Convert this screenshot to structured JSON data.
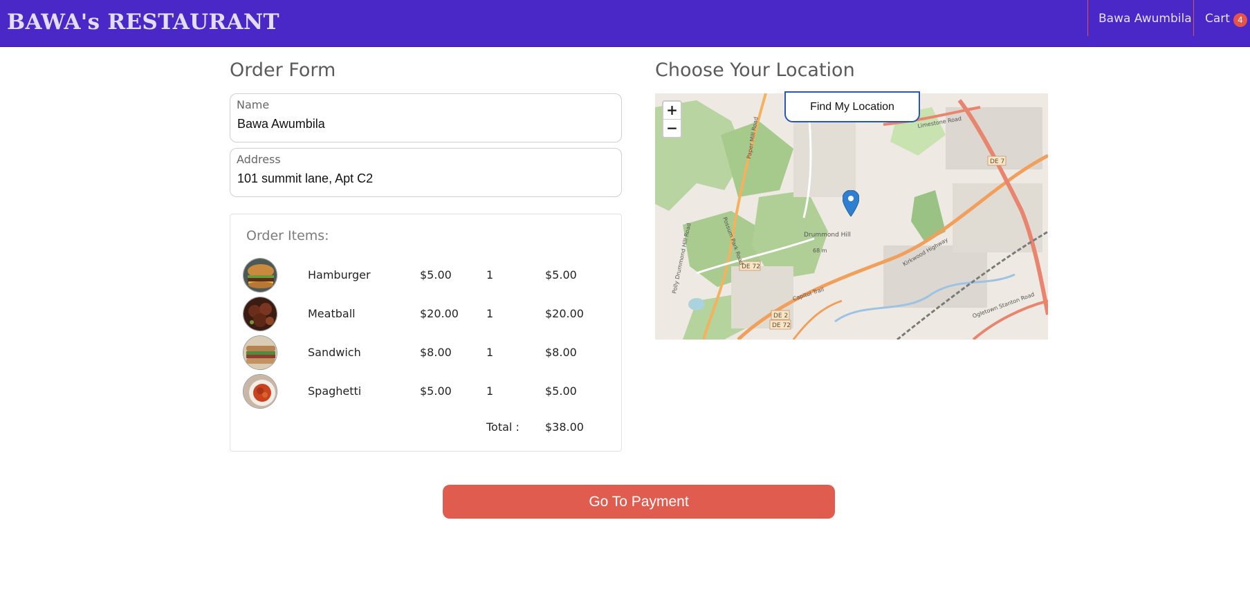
{
  "navbar": {
    "brand": "BAWA's RESTAURANT",
    "user_name": "Bawa Awumbila",
    "cart_label": "Cart",
    "cart_count": "4"
  },
  "order_form": {
    "title": "Order Form",
    "name_label": "Name",
    "name_value": "Bawa Awumbila",
    "address_label": "Address",
    "address_value": "101 summit lane, Apt C2"
  },
  "order_items": {
    "title": "Order Items:",
    "items": [
      {
        "name": "Hamburger",
        "price": "$5.00",
        "qty": "1",
        "subtotal": "$5.00"
      },
      {
        "name": "Meatball",
        "price": "$20.00",
        "qty": "1",
        "subtotal": "$20.00"
      },
      {
        "name": "Sandwich",
        "price": "$8.00",
        "qty": "1",
        "subtotal": "$8.00"
      },
      {
        "name": "Spaghetti",
        "price": "$5.00",
        "qty": "1",
        "subtotal": "$5.00"
      }
    ],
    "total_label": "Total :",
    "total_value": "$38.00"
  },
  "location": {
    "title": "Choose Your Location",
    "find_button": "Find My Location",
    "zoom_in": "+",
    "zoom_out": "−",
    "map_labels": [
      "DE 7",
      "DE 72",
      "DE 2",
      "DE 72",
      "Drummond Hill",
      "68 m",
      "Capitol Trail",
      "Kirkwood Highway",
      "Possum Park Road",
      "Paper Mill Road",
      "Polly Drummond Hill Road",
      "Limestone Road",
      "Ogletown Stanton Road"
    ]
  },
  "payment": {
    "button": "Go To Payment"
  },
  "colors": {
    "navbar": "#4a27c7",
    "accent": "#e05c4e",
    "marker": "#2f7fd0"
  }
}
